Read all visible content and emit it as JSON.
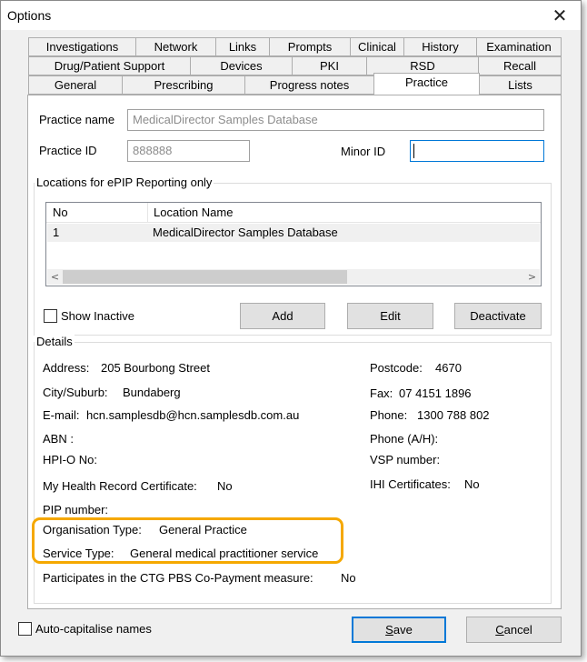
{
  "window": {
    "title": "Options",
    "close_glyph": "✕"
  },
  "tabs": {
    "row1": [
      "Investigations",
      "Network",
      "Links",
      "Prompts",
      "Clinical",
      "History",
      "Examination"
    ],
    "row2": [
      "Drug/Patient Support",
      "Devices",
      "PKI",
      "RSD",
      "Recall"
    ],
    "row3": [
      "General",
      "Prescribing",
      "Progress notes",
      "Practice",
      "Lists"
    ],
    "active": "Practice"
  },
  "practice": {
    "name_label": "Practice name",
    "name_value": "MedicalDirector Samples Database",
    "id_label": "Practice ID",
    "id_value": "888888",
    "minor_label": "Minor ID",
    "minor_value": ""
  },
  "locations": {
    "title": "Locations for ePIP Reporting only",
    "columns": [
      "No",
      "Location Name"
    ],
    "rows": [
      {
        "no": "1",
        "name": "MedicalDirector Samples Database"
      }
    ],
    "scroll_left": "<",
    "scroll_right": ">",
    "show_inactive_label": "Show Inactive",
    "show_inactive_checked": false,
    "add_label": "Add",
    "edit_label": "Edit",
    "deactivate_label": "Deactivate"
  },
  "details": {
    "title": "Details",
    "address_label": "Address:",
    "address_value": "205 Bourbong Street",
    "city_label": "City/Suburb:",
    "city_value": "Bundaberg",
    "email_label": "E-mail:",
    "email_value": "hcn.samplesdb@hcn.samplesdb.com.au",
    "abn_label": "ABN :",
    "hpio_label": "HPI-O No:",
    "mhr_label": "My Health Record Certificate:",
    "mhr_value": "No",
    "pip_label": "PIP number:",
    "org_type_label": "Organisation Type:",
    "org_type_value": "General Practice",
    "service_type_label": "Service Type:",
    "service_type_value": "General medical practitioner service",
    "ctg_label": "Participates in the CTG PBS Co-Payment measure:",
    "ctg_value": "No",
    "postcode_label": "Postcode:",
    "postcode_value": "4670",
    "fax_label": "Fax:",
    "fax_value": "07 4151 1896",
    "phone_label": "Phone:",
    "phone_value": "1300 788 802",
    "phone_ah_label": "Phone (A/H):",
    "vsp_label": "VSP number:",
    "ihi_label": "IHI Certificates:",
    "ihi_value": "No"
  },
  "footer": {
    "autocap_label": "Auto-capitalise names",
    "autocap_checked": false,
    "save_mnemonic": "S",
    "save_rest": "ave",
    "cancel_mnemonic": "C",
    "cancel_rest": "ancel"
  },
  "colors": {
    "highlight": "#f5a800",
    "focus_border": "#0078d7"
  }
}
